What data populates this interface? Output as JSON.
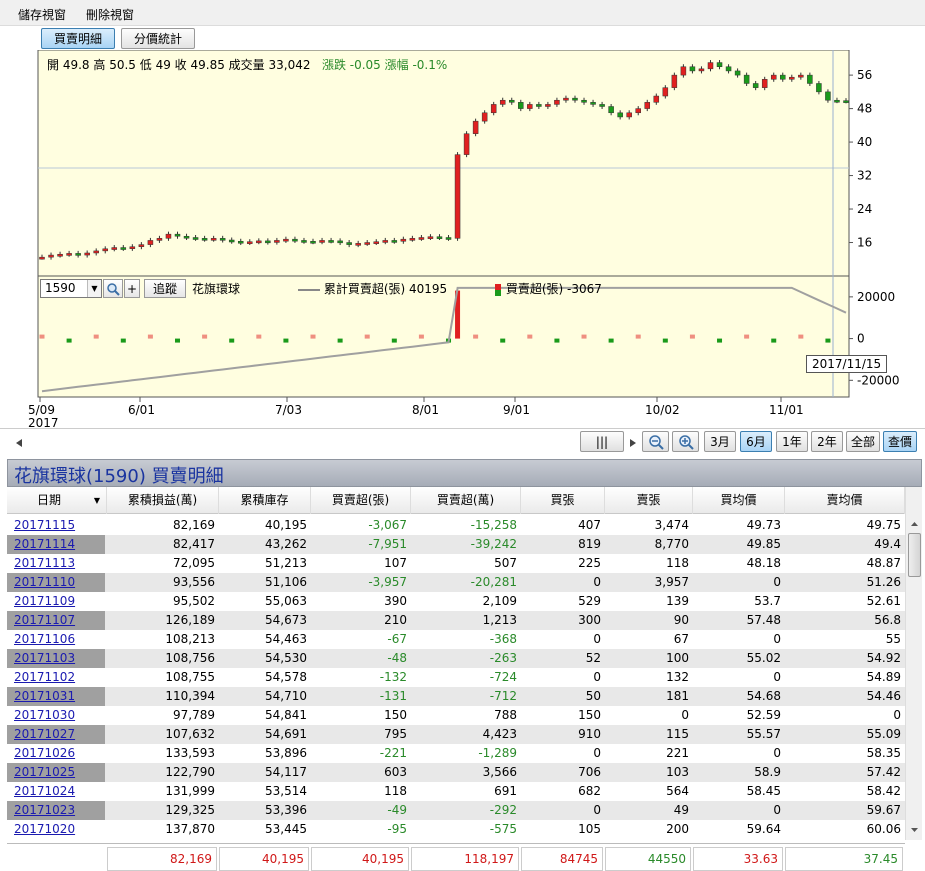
{
  "menu": {
    "save_view": "儲存視窗",
    "delete_view": "刪除視窗"
  },
  "tabs": [
    {
      "label": "買賣明細",
      "active": true
    },
    {
      "label": "分價統計",
      "active": false
    }
  ],
  "price_header": {
    "open": "開 49.8",
    "high": "高 50.5",
    "low": "低 49",
    "close": "收 49.85",
    "volume": "成交量 33,042",
    "change": "漲跌 -0.05",
    "change_pct": "漲幅 -0.1%"
  },
  "controls": {
    "code": "1590",
    "track_label": "追蹤",
    "stock_name": "花旗環球",
    "legend_cum": "累計買賣超(張) 40195",
    "legend_daily": "買賣超(張) -3067"
  },
  "tooltip": "2017/11/15",
  "nav": {
    "zoom_out": "zoom-out",
    "zoom_in": "zoom-in",
    "ranges": [
      "3月",
      "6月",
      "1年",
      "2年",
      "全部"
    ],
    "active_range": "6月",
    "query_label": "查價"
  },
  "table_title": "花旗環球(1590) 買賣明細",
  "chart_data": [
    {
      "type": "candlestick",
      "x_labels": [
        "5/09\n2017",
        "6/01",
        "7/03",
        "8/01",
        "9/01",
        "10/02",
        "11/01"
      ],
      "y_ticks": [
        16,
        24,
        32,
        40,
        48,
        56
      ],
      "ylim": [
        8,
        62
      ],
      "description_series": "daily prices approximated",
      "series": [
        {
          "values": [
            12.5,
            13,
            13.2,
            13.4,
            13,
            13.5,
            14,
            14.5,
            14.8,
            14.6,
            15,
            15.5,
            16.5,
            17,
            18,
            17.5,
            17.2,
            17,
            16.8,
            17,
            16.6,
            16.3,
            16,
            16.2,
            16.4,
            16.1,
            16.5,
            16.8,
            16.5,
            16.3,
            16.2,
            16.5,
            16.4,
            16,
            15.5,
            15.8,
            16,
            16.2,
            16.5,
            16.3,
            16.8,
            17,
            17.2,
            17.4,
            17.2,
            17,
            37,
            42,
            45,
            47,
            49,
            50,
            49.5,
            48,
            49,
            48.5,
            49,
            50,
            50.5,
            50,
            49.5,
            49,
            48.5,
            47,
            46,
            47,
            48,
            49.5,
            51,
            53,
            56,
            58,
            57,
            57.5,
            59,
            58,
            57,
            56,
            54,
            53,
            55,
            56,
            55,
            55.5,
            56,
            54,
            52,
            50,
            49.9,
            49.85
          ]
        }
      ]
    },
    {
      "type": "bar+line",
      "y_ticks": [
        20000,
        0,
        -20000
      ],
      "ylim": [
        -28000,
        30000
      ],
      "cumulative_end": 40195,
      "daily_last": -3067
    }
  ],
  "table": {
    "headers": [
      "日期",
      "累積損益(萬)",
      "累積庫存",
      "買賣超(張)",
      "買賣超(萬)",
      "買張",
      "賣張",
      "買均價",
      "賣均價"
    ],
    "rows": [
      [
        "20171115",
        "82,169",
        "40,195",
        "-3,067",
        "-15,258",
        "407",
        "3,474",
        "49.73",
        "49.75"
      ],
      [
        "20171114",
        "82,417",
        "43,262",
        "-7,951",
        "-39,242",
        "819",
        "8,770",
        "49.85",
        "49.4"
      ],
      [
        "20171113",
        "72,095",
        "51,213",
        "107",
        "507",
        "225",
        "118",
        "48.18",
        "48.87"
      ],
      [
        "20171110",
        "93,556",
        "51,106",
        "-3,957",
        "-20,281",
        "0",
        "3,957",
        "0",
        "51.26"
      ],
      [
        "20171109",
        "95,502",
        "55,063",
        "390",
        "2,109",
        "529",
        "139",
        "53.7",
        "52.61"
      ],
      [
        "20171107",
        "126,189",
        "54,673",
        "210",
        "1,213",
        "300",
        "90",
        "57.48",
        "56.8"
      ],
      [
        "20171106",
        "108,213",
        "54,463",
        "-67",
        "-368",
        "0",
        "67",
        "0",
        "55"
      ],
      [
        "20171103",
        "108,756",
        "54,530",
        "-48",
        "-263",
        "52",
        "100",
        "55.02",
        "54.92"
      ],
      [
        "20171102",
        "108,755",
        "54,578",
        "-132",
        "-724",
        "0",
        "132",
        "0",
        "54.89"
      ],
      [
        "20171031",
        "110,394",
        "54,710",
        "-131",
        "-712",
        "50",
        "181",
        "54.68",
        "54.46"
      ],
      [
        "20171030",
        "97,789",
        "54,841",
        "150",
        "788",
        "150",
        "0",
        "52.59",
        "0"
      ],
      [
        "20171027",
        "107,632",
        "54,691",
        "795",
        "4,423",
        "910",
        "115",
        "55.57",
        "55.09"
      ],
      [
        "20171026",
        "133,593",
        "53,896",
        "-221",
        "-1,289",
        "0",
        "221",
        "0",
        "58.35"
      ],
      [
        "20171025",
        "122,790",
        "54,117",
        "603",
        "3,566",
        "706",
        "103",
        "58.9",
        "57.42"
      ],
      [
        "20171024",
        "131,999",
        "53,514",
        "118",
        "691",
        "682",
        "564",
        "58.45",
        "58.42"
      ],
      [
        "20171023",
        "129,325",
        "53,396",
        "-49",
        "-292",
        "0",
        "49",
        "0",
        "59.67"
      ],
      [
        "20171020",
        "137,870",
        "53,445",
        "-95",
        "-575",
        "105",
        "200",
        "59.64",
        "60.06"
      ]
    ],
    "summary": [
      "82,169",
      "40,195",
      "40,195",
      "118,197",
      "84745",
      "44550",
      "33.63",
      "37.45"
    ]
  },
  "colors": {
    "chart_bg": "#fffee0",
    "up": "#e02020",
    "down": "#1a9a1a",
    "cum_line": "#a0a0a0",
    "stripe": "#e8e8e8"
  }
}
